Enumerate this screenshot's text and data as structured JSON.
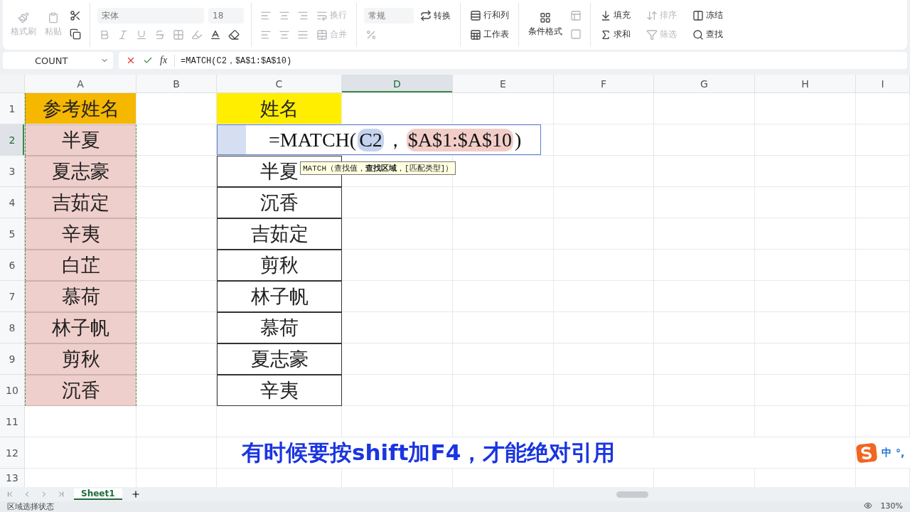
{
  "ribbon": {
    "clipboard": [
      {
        "label": "格式刷",
        "disabled": true
      },
      {
        "label": "粘贴",
        "disabled": true
      }
    ],
    "font": {
      "name": "宋体",
      "size": "18"
    },
    "alignment": [
      {
        "label": "换行",
        "disabled": true
      },
      {
        "label": "合并",
        "disabled": true
      }
    ],
    "number": {
      "format": "常规",
      "convert": "转换"
    },
    "tools": [
      {
        "label": "行和列",
        "disabled": false
      },
      {
        "label": "工作表",
        "disabled": false
      }
    ],
    "conditional_format": "条件格式",
    "edit": [
      {
        "label": "填充",
        "disabled": false
      },
      {
        "label": "排序",
        "disabled": true
      },
      {
        "label": "冻结",
        "disabled": false
      },
      {
        "label": "求和",
        "disabled": false
      },
      {
        "label": "筛选",
        "disabled": true
      },
      {
        "label": "查找",
        "disabled": false
      }
    ]
  },
  "name_box": "COUNT",
  "formula_icon": "fx",
  "formula": "=MATCH(C2，$A$1:$A$10)",
  "columns": [
    {
      "label": "A",
      "selected": false
    },
    {
      "label": "B",
      "selected": false
    },
    {
      "label": "C",
      "selected": false
    },
    {
      "label": "D",
      "selected": true
    },
    {
      "label": "E",
      "selected": false
    },
    {
      "label": "F",
      "selected": false
    },
    {
      "label": "G",
      "selected": false
    },
    {
      "label": "H",
      "selected": false
    },
    {
      "label": "I",
      "selected": false
    }
  ],
  "rows": [
    {
      "label": "1",
      "selected": false,
      "reference": {
        "text": "参考姓名",
        "kind": "header"
      },
      "lookup": {
        "text": "姓名",
        "kind": "header"
      }
    },
    {
      "label": "2",
      "selected": true,
      "reference": {
        "text": "半夏",
        "kind": "value"
      },
      "lookup": {
        "kind": "editing"
      }
    },
    {
      "label": "3",
      "selected": false,
      "reference": {
        "text": "夏志豪",
        "kind": "value"
      },
      "lookup": {
        "text": "半夏",
        "kind": "value"
      }
    },
    {
      "label": "4",
      "selected": false,
      "reference": {
        "text": "吉茹定",
        "kind": "value"
      },
      "lookup": {
        "text": "沉香",
        "kind": "value"
      }
    },
    {
      "label": "5",
      "selected": false,
      "reference": {
        "text": "辛夷",
        "kind": "value"
      },
      "lookup": {
        "text": "吉茹定",
        "kind": "value"
      }
    },
    {
      "label": "6",
      "selected": false,
      "reference": {
        "text": "白芷",
        "kind": "value"
      },
      "lookup": {
        "text": "剪秋",
        "kind": "value"
      }
    },
    {
      "label": "7",
      "selected": false,
      "reference": {
        "text": "慕荷",
        "kind": "value"
      },
      "lookup": {
        "text": "林子帆",
        "kind": "value"
      }
    },
    {
      "label": "8",
      "selected": false,
      "reference": {
        "text": "林子帆",
        "kind": "value"
      },
      "lookup": {
        "text": "慕荷",
        "kind": "value"
      }
    },
    {
      "label": "9",
      "selected": false,
      "reference": {
        "text": "剪秋",
        "kind": "value"
      },
      "lookup": {
        "text": "夏志豪",
        "kind": "value"
      }
    },
    {
      "label": "10",
      "selected": false,
      "reference": {
        "text": "沉香",
        "kind": "value"
      },
      "lookup": {
        "text": "辛夷",
        "kind": "value"
      }
    },
    {
      "label": "11",
      "selected": false
    },
    {
      "label": "12",
      "selected": false
    },
    {
      "label": "13",
      "selected": false
    }
  ],
  "editor": {
    "parts": [
      {
        "text": "=MATCH(",
        "kind": "plain"
      },
      {
        "text": "C2",
        "kind": "ref",
        "color": "#c5d3ee"
      },
      {
        "text": "，",
        "kind": "plain"
      },
      {
        "text": "$A$1:$A$10",
        "kind": "ref",
        "color": "#f2cdc8"
      },
      {
        "text": ")",
        "kind": "plain"
      }
    ],
    "tooltip": "MATCH（查找值，**查找区域**，[匹配类型]）"
  },
  "caption": "有时候要按shift加F4，才能绝对引用",
  "ime": {
    "mode": "中",
    "punctuation": "°,"
  },
  "sheets": [
    {
      "label": "Sheet1",
      "selected": true
    }
  ],
  "status": {
    "text": "区域选择状态",
    "zoom": "130%"
  }
}
